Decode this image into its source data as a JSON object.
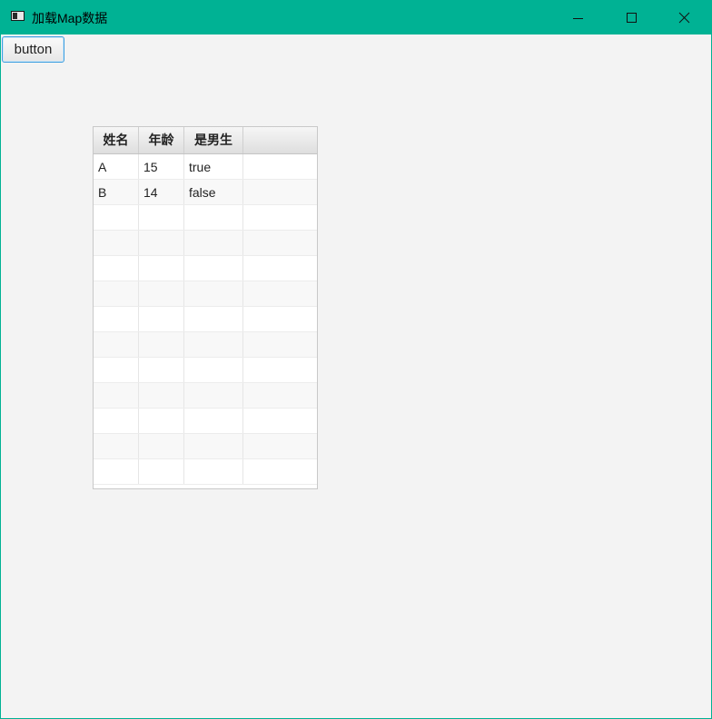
{
  "window": {
    "title": "加载Map数据",
    "accent_color": "#00b294",
    "controls": {
      "minimize_icon": "minimize-icon",
      "maximize_icon": "maximize-icon",
      "close_icon": "close-icon"
    }
  },
  "toolbar": {
    "button_label": "button"
  },
  "table": {
    "columns": [
      "姓名",
      "年龄",
      "是男生",
      ""
    ],
    "rows": [
      [
        "A",
        "15",
        "true",
        ""
      ],
      [
        "B",
        "14",
        "false",
        ""
      ],
      [
        "",
        "",
        "",
        ""
      ],
      [
        "",
        "",
        "",
        ""
      ],
      [
        "",
        "",
        "",
        ""
      ],
      [
        "",
        "",
        "",
        ""
      ],
      [
        "",
        "",
        "",
        ""
      ],
      [
        "",
        "",
        "",
        ""
      ],
      [
        "",
        "",
        "",
        ""
      ],
      [
        "",
        "",
        "",
        ""
      ],
      [
        "",
        "",
        "",
        ""
      ],
      [
        "",
        "",
        "",
        ""
      ],
      [
        "",
        "",
        "",
        ""
      ]
    ]
  }
}
